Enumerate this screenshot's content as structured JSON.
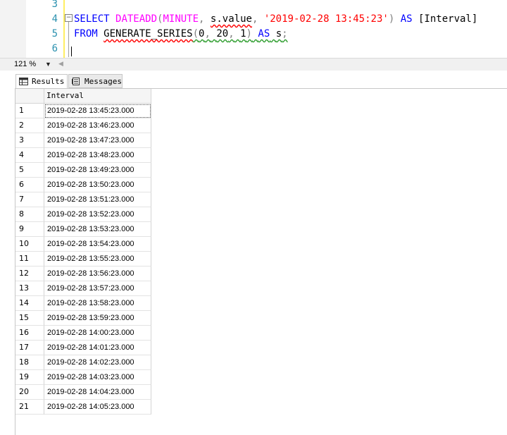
{
  "editor": {
    "line_numbers": [
      "3",
      "4",
      "5",
      "6"
    ],
    "line4": {
      "t1": "SELECT",
      "t2": "DATEADD",
      "t3": "(",
      "t4": "MINUTE",
      "t5": ",",
      "t6": "s.value",
      "t7": ",",
      "t8": "'2019-02-28 13:45:23'",
      "t9": ")",
      "t10": "AS",
      "t11": "[Interval]"
    },
    "line5": {
      "t1": "FROM",
      "t2": "GENERATE_SERIES",
      "t3": "(",
      "t4": "0",
      "t5": ",",
      "t6": "20",
      "t7": ",",
      "t8": "1",
      "t9": ")",
      "t10": "AS",
      "t11": "s",
      "t12": ";"
    }
  },
  "zoom": {
    "value": "121 %"
  },
  "tabs": {
    "results": "Results",
    "messages": "Messages"
  },
  "grid": {
    "column": "Interval",
    "rows": [
      {
        "n": "1",
        "v": "2019-02-28 13:45:23.000"
      },
      {
        "n": "2",
        "v": "2019-02-28 13:46:23.000"
      },
      {
        "n": "3",
        "v": "2019-02-28 13:47:23.000"
      },
      {
        "n": "4",
        "v": "2019-02-28 13:48:23.000"
      },
      {
        "n": "5",
        "v": "2019-02-28 13:49:23.000"
      },
      {
        "n": "6",
        "v": "2019-02-28 13:50:23.000"
      },
      {
        "n": "7",
        "v": "2019-02-28 13:51:23.000"
      },
      {
        "n": "8",
        "v": "2019-02-28 13:52:23.000"
      },
      {
        "n": "9",
        "v": "2019-02-28 13:53:23.000"
      },
      {
        "n": "10",
        "v": "2019-02-28 13:54:23.000"
      },
      {
        "n": "11",
        "v": "2019-02-28 13:55:23.000"
      },
      {
        "n": "12",
        "v": "2019-02-28 13:56:23.000"
      },
      {
        "n": "13",
        "v": "2019-02-28 13:57:23.000"
      },
      {
        "n": "14",
        "v": "2019-02-28 13:58:23.000"
      },
      {
        "n": "15",
        "v": "2019-02-28 13:59:23.000"
      },
      {
        "n": "16",
        "v": "2019-02-28 14:00:23.000"
      },
      {
        "n": "17",
        "v": "2019-02-28 14:01:23.000"
      },
      {
        "n": "18",
        "v": "2019-02-28 14:02:23.000"
      },
      {
        "n": "19",
        "v": "2019-02-28 14:03:23.000"
      },
      {
        "n": "20",
        "v": "2019-02-28 14:04:23.000"
      },
      {
        "n": "21",
        "v": "2019-02-28 14:05:23.000"
      }
    ]
  }
}
